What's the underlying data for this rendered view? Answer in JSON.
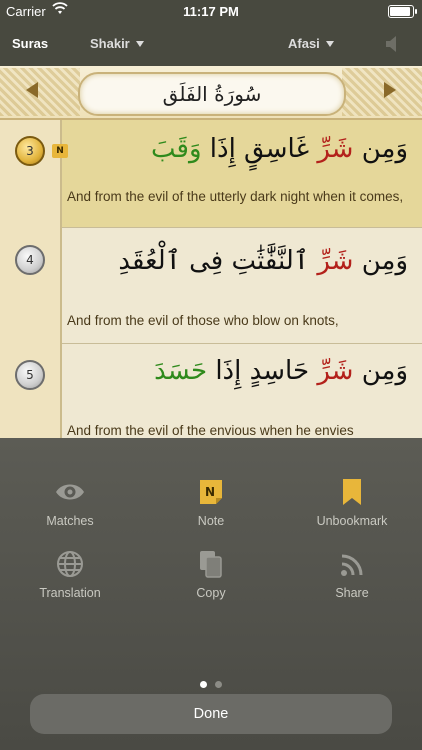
{
  "status_bar": {
    "carrier": "Carrier",
    "time": "11:17 PM"
  },
  "nav": {
    "suras": "Suras",
    "translator": "Shakir",
    "reciter": "Afasi"
  },
  "header": {
    "sura_title": "سُورَةُ الفَلَق"
  },
  "verses": [
    {
      "number": "3",
      "note_badge": "N",
      "arabic_a": "وَمِن",
      "arabic_b": "شَرِّ",
      "arabic_c": "غَاسِقٍ إِذَا",
      "arabic_d": "وَقَبَ",
      "english": "And from the evil of the utterly dark night when it comes,"
    },
    {
      "number": "4",
      "arabic_a": "وَمِن",
      "arabic_b": "شَرِّ",
      "arabic_c": "ٱلنَّفَّٰثَٰتِ فِى",
      "arabic_d": "ٱلْعُقَدِ",
      "english": "And from the evil of those who blow on knots,"
    },
    {
      "number": "5",
      "arabic_a": "وَمِن",
      "arabic_b": "شَرِّ",
      "arabic_c": "حَاسِدٍ إِذَا",
      "arabic_d": "حَسَدَ",
      "english": "And from the evil of the envious when he envies"
    }
  ],
  "actions": {
    "matches": "Matches",
    "note": "Note",
    "unbookmark": "Unbookmark",
    "translation": "Translation",
    "copy": "Copy",
    "share": "Share"
  },
  "pager": {
    "page": 1,
    "count": 2
  },
  "done_label": "Done",
  "colors": {
    "accent_gold": "#e8b63a",
    "selected_row": "#e5d79a",
    "red_text": "#b3211b",
    "green_text": "#2f8a1c"
  }
}
